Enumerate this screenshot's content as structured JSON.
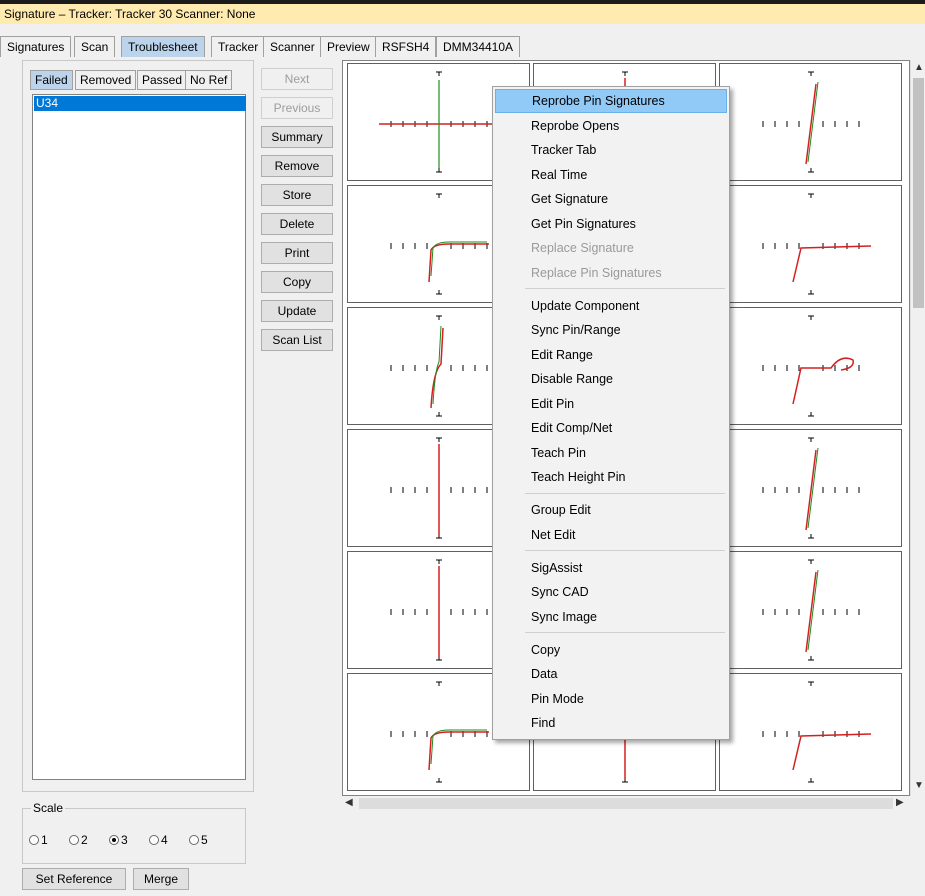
{
  "window": {
    "title": "Signature – Tracker: Tracker 30  Scanner: None"
  },
  "tabs": [
    "Signatures",
    "Scan",
    "Troublesheet",
    "Tracker",
    "Scanner",
    "Preview",
    "RSFSH4",
    "DMM34410A"
  ],
  "active_tab": "Troublesheet",
  "subtabs": [
    "Failed",
    "Removed",
    "Passed",
    "No Ref"
  ],
  "active_subtab": "Failed",
  "list": {
    "items": [
      "U34"
    ],
    "selected": "U34"
  },
  "buttons": {
    "next": "Next",
    "previous": "Previous",
    "summary": "Summary",
    "remove": "Remove",
    "store": "Store",
    "delete": "Delete",
    "print": "Print",
    "copy": "Copy",
    "update": "Update",
    "scan_list": "Scan List"
  },
  "scale": {
    "label": "Scale",
    "options": [
      "1",
      "2",
      "3",
      "4",
      "5"
    ],
    "selected": "3"
  },
  "bottom_buttons": {
    "set_reference": "Set Reference",
    "merge": "Merge"
  },
  "context_menu": {
    "items": [
      {
        "label": "Reprobe Pin Signatures",
        "enabled": true,
        "highlighted": true
      },
      {
        "label": "Reprobe Opens",
        "enabled": true
      },
      {
        "label": "Tracker Tab",
        "enabled": true
      },
      {
        "label": "Real Time",
        "enabled": true
      },
      {
        "label": "Get Signature",
        "enabled": true
      },
      {
        "label": "Get Pin Signatures",
        "enabled": true
      },
      {
        "label": "Replace Signature",
        "enabled": false
      },
      {
        "label": "Replace Pin Signatures",
        "enabled": false
      },
      {
        "label": "Update Component",
        "enabled": true
      },
      {
        "label": "Sync Pin/Range",
        "enabled": true
      },
      {
        "label": "Edit Range",
        "enabled": true
      },
      {
        "label": "Disable Range",
        "enabled": true
      },
      {
        "label": "Edit Pin",
        "enabled": true
      },
      {
        "label": "Edit Comp/Net",
        "enabled": true
      },
      {
        "label": "Teach Pin",
        "enabled": true
      },
      {
        "label": "Teach Height Pin",
        "enabled": true
      },
      {
        "label": "Group Edit",
        "enabled": true
      },
      {
        "label": "Net Edit",
        "enabled": true
      },
      {
        "label": "SigAssist",
        "enabled": true
      },
      {
        "label": "Sync CAD",
        "enabled": true
      },
      {
        "label": "Sync Image",
        "enabled": true
      },
      {
        "label": "Copy",
        "enabled": true
      },
      {
        "label": "Data",
        "enabled": true
      },
      {
        "label": "Pin Mode",
        "enabled": true
      },
      {
        "label": "Find",
        "enabled": true
      }
    ]
  },
  "colors": {
    "accent": "#0078d7",
    "title_bg": "#ffebb0",
    "trace_red": "#d42020",
    "trace_green": "#1f8a1f"
  }
}
